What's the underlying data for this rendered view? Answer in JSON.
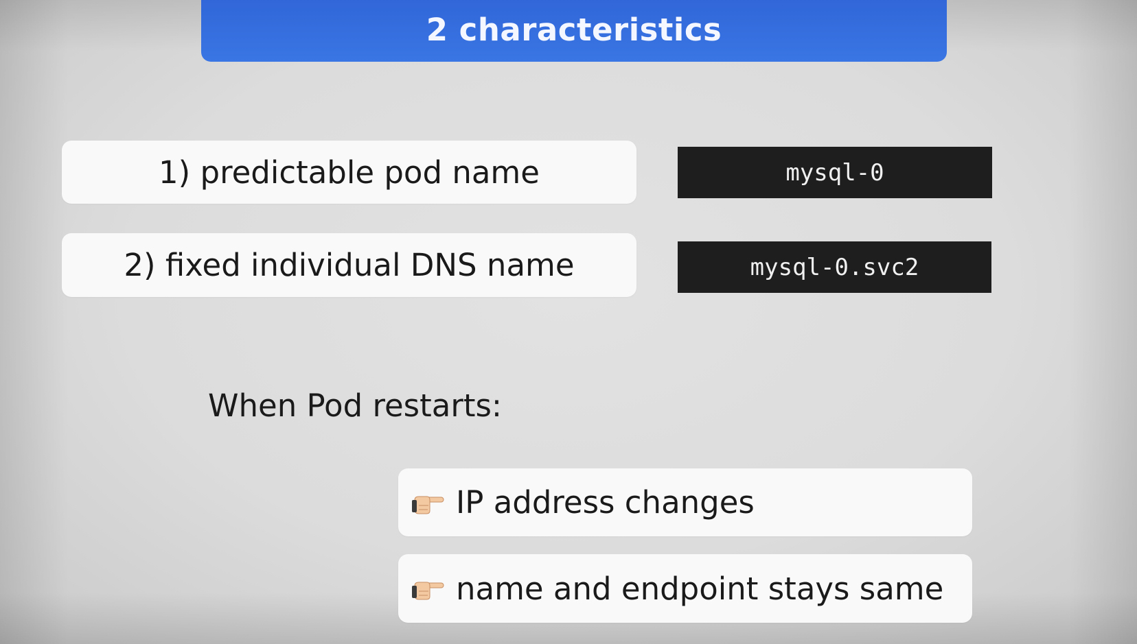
{
  "title": "2 characteristics",
  "characteristics": [
    {
      "label": "1) predictable pod name",
      "example": "mysql-0"
    },
    {
      "label": "2) fixed individual DNS name",
      "example": "mysql-0.svc2"
    }
  ],
  "restart_heading": "When Pod restarts:",
  "bullets": [
    {
      "icon": "pointing-hand-icon",
      "text": "IP address changes"
    },
    {
      "icon": "pointing-hand-icon",
      "text": "name and endpoint stays same"
    }
  ],
  "colors": {
    "title_bar": "#3a76e4",
    "background": "#dcdcdc",
    "code_box": "#1e1e1e",
    "pill": "#f9f9f9"
  }
}
